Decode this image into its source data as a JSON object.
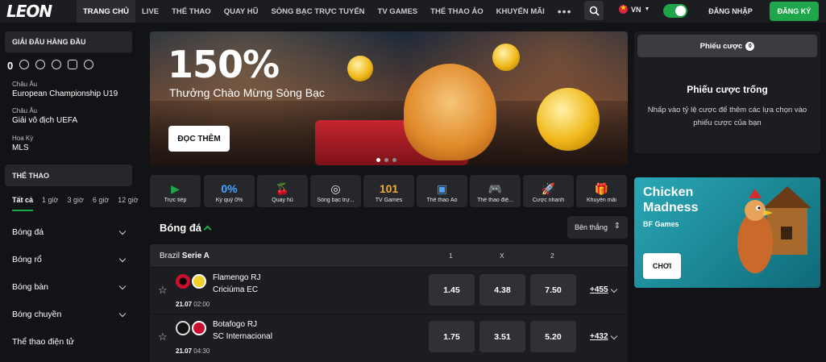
{
  "header": {
    "logo": "LEON",
    "nav": [
      "TRANG CHỦ",
      "LIVE",
      "THỂ THAO",
      "QUAY HŨ",
      "SÒNG BẠC TRỰC TUYẾN",
      "TV GAMES",
      "THỂ THAO ẢO",
      "KHUYẾN MÃI"
    ],
    "more": "•••",
    "lang": "VN",
    "login": "ĐĂNG NHẬP",
    "register": "ĐĂNG KÝ",
    "accent": "#1fa64b"
  },
  "sidebar": {
    "top_title": "GIẢI ĐẤU HÀNG ĐẦU",
    "sport_count": "0",
    "leagues": [
      {
        "region": "Châu Âu",
        "name": "European Championship U19"
      },
      {
        "region": "Châu Âu",
        "name": "Giải vô địch UEFA"
      },
      {
        "region": "Hoa Kỳ",
        "name": "MLS"
      }
    ],
    "sports_title": "THỂ THAO",
    "time_tabs": [
      "Tất cả",
      "1 giờ",
      "3 giờ",
      "6 giờ",
      "12 giờ"
    ],
    "sports": [
      "Bóng đá",
      "Bóng rổ",
      "Bóng bàn",
      "Bóng chuyền",
      "Thể thao điện tử"
    ]
  },
  "banner": {
    "headline": "150%",
    "subline": "Thưởng Chào Mừng Sòng Bạc",
    "cta": "ĐỌC THÊM"
  },
  "quick_links": [
    {
      "icon": "▶",
      "label": "Trực tiếp"
    },
    {
      "icon": "0%",
      "label": "Ký quỹ 0%"
    },
    {
      "icon": "🍒",
      "label": "Quay hũ"
    },
    {
      "icon": "◎",
      "label": "Sòng bạc trự..."
    },
    {
      "icon": "101",
      "label": "TV Games"
    },
    {
      "icon": "▣",
      "label": "Thể thao Ảo"
    },
    {
      "icon": "🎮",
      "label": "Thể thao điệ..."
    },
    {
      "icon": "🚀",
      "label": "Cược nhanh"
    },
    {
      "icon": "🎁",
      "label": "Khuyến mãi"
    }
  ],
  "events": {
    "section_title": "Bóng đá",
    "sort_label": "Bên thắng",
    "league_country": "Brazil",
    "league_name": "Serie A",
    "col_1": "1",
    "col_x": "X",
    "col_2": "2",
    "matches": [
      {
        "home": "Flamengo RJ",
        "away": "Criciúma EC",
        "date": "21.07",
        "time": "02:00",
        "o1": "1.45",
        "ox": "4.38",
        "o2": "7.50",
        "more": "+455"
      },
      {
        "home": "Botafogo RJ",
        "away": "SC Internacional",
        "date": "21.07",
        "time": "04:30",
        "o1": "1.75",
        "ox": "3.51",
        "o2": "5.20",
        "more": "+432"
      }
    ]
  },
  "betslip": {
    "tab_label": "Phiếu cược",
    "count": "0",
    "empty_title": "Phiếu cược trống",
    "empty_hint": "Nhấp vào tỷ lệ cược để thêm các lựa chọn vào phiếu cược của bạn"
  },
  "promo": {
    "title": "Chicken Madness",
    "provider": "BF Games",
    "cta": "CHƠI"
  }
}
